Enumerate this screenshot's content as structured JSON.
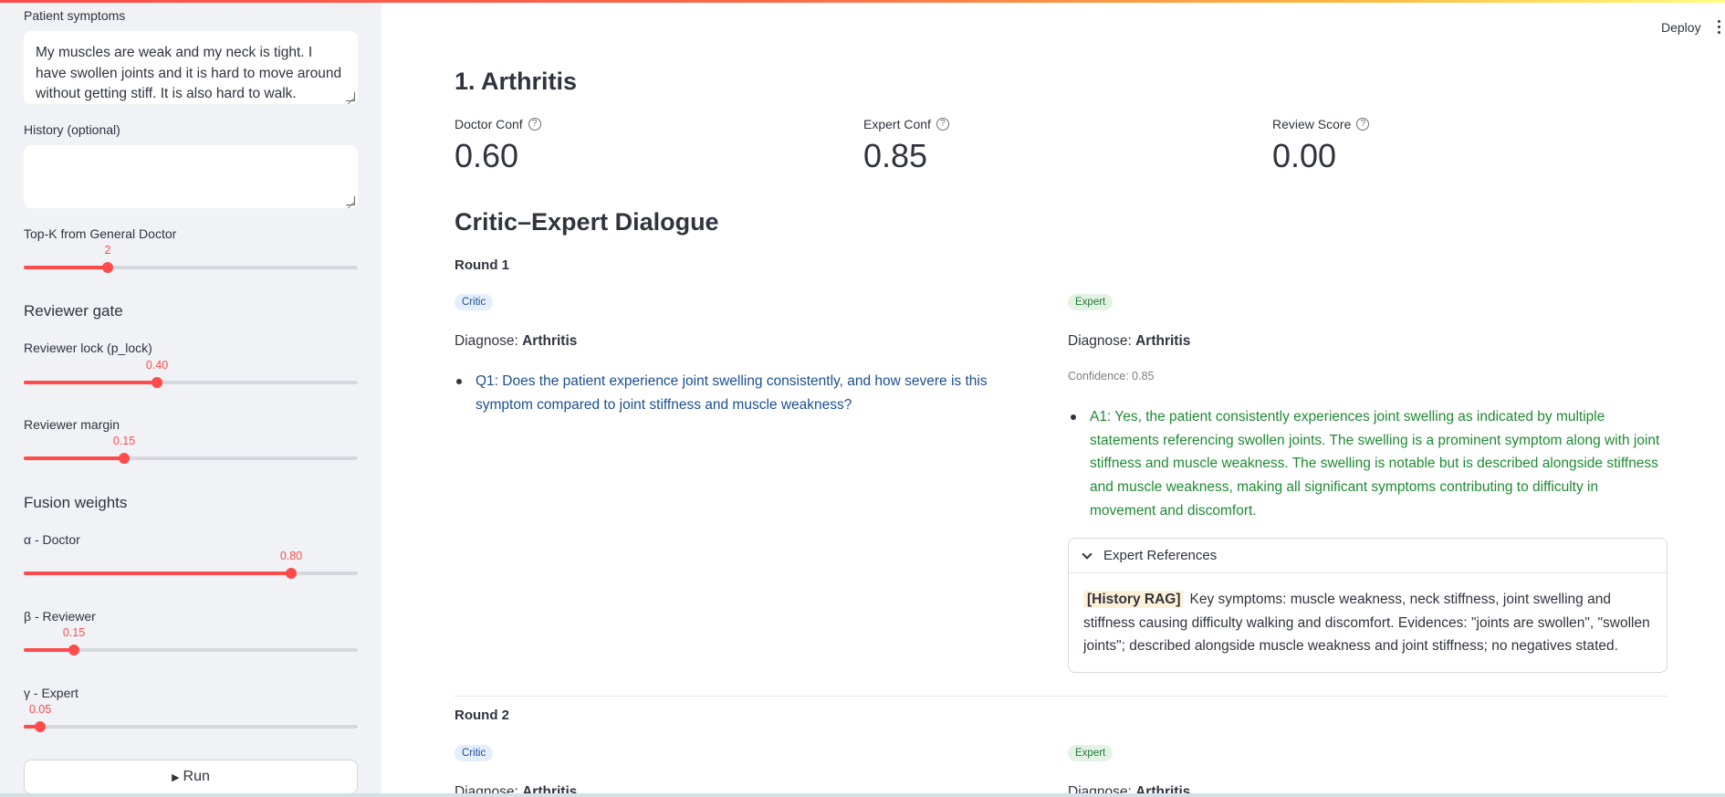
{
  "sidebar": {
    "symptoms_label": "Patient symptoms",
    "symptoms_value": "My muscles are weak and my neck is tight. I have swollen joints and it is hard to move around without getting stiff. It is also hard to walk.",
    "history_label": "History (optional)",
    "history_value": "",
    "topk": {
      "label": "Top-K from General Doctor",
      "value": "2",
      "fraction": 0.25
    },
    "reviewer_gate_heading": "Reviewer gate",
    "reviewer_lock": {
      "label": "Reviewer lock (p_lock)",
      "value": "0.40",
      "fraction": 0.4
    },
    "reviewer_margin": {
      "label": "Reviewer margin",
      "value": "0.15",
      "fraction": 0.3
    },
    "fusion_heading": "Fusion weights",
    "alpha": {
      "label": "α - Doctor",
      "value": "0.80",
      "fraction": 0.8
    },
    "beta": {
      "label": "β - Reviewer",
      "value": "0.15",
      "fraction": 0.15
    },
    "gamma": {
      "label": "γ - Expert",
      "value": "0.05",
      "fraction": 0.05
    },
    "run_label": "Run"
  },
  "header": {
    "deploy_label": "Deploy"
  },
  "main": {
    "title": "1. Arthritis",
    "metrics": [
      {
        "label": "Doctor Conf",
        "value": "0.60"
      },
      {
        "label": "Expert Conf",
        "value": "0.85"
      },
      {
        "label": "Review Score",
        "value": "0.00"
      }
    ],
    "dialogue_heading": "Critic–Expert Dialogue",
    "round1": {
      "label": "Round 1",
      "critic_badge": "Critic",
      "expert_badge": "Expert",
      "diagnose_prefix": "Diagnose:",
      "critic_diagnosis": "Arthritis",
      "expert_diagnosis": "Arthritis",
      "expert_confidence": "Confidence: 0.85",
      "question": "Q1: Does the patient experience joint swelling consistently, and how severe is this symptom compared to joint stiffness and muscle weakness?",
      "answer": "A1: Yes, the patient consistently experiences joint swelling as indicated by multiple statements referencing swollen joints. The swelling is a prominent symptom along with joint stiffness and muscle weakness. The swelling is notable but is described alongside stiffness and muscle weakness, making all significant symptoms contributing to difficulty in movement and discomfort.",
      "references_title": "Expert References",
      "reference_tag": "[History RAG]",
      "reference_text": "Key symptoms: muscle weakness, neck stiffness, joint swelling and stiffness causing difficulty walking and discomfort. Evidences: \"joints are swollen\", \"swollen joints\"; described alongside muscle weakness and joint stiffness; no negatives stated."
    },
    "round2": {
      "label": "Round 2",
      "critic_badge": "Critic",
      "expert_badge": "Expert",
      "diagnose_prefix": "Diagnose:",
      "critic_diagnosis": "Arthritis",
      "expert_diagnosis": "Arthritis"
    }
  },
  "colors": {
    "accent": "#ff4b4b",
    "sidebar_bg": "#f0f2f6",
    "question": "#1c4f8e",
    "answer": "#1f8a32"
  },
  "icons": [
    "help-icon",
    "chevron-down-icon",
    "play-icon",
    "more-vert-icon"
  ]
}
